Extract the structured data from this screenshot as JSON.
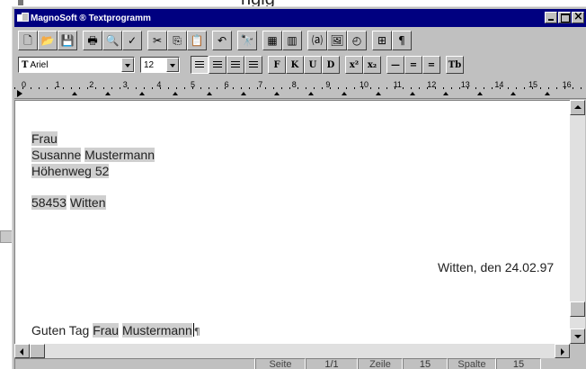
{
  "background": {
    "caption": "ngig"
  },
  "window": {
    "title": "MagnoSoft ® Textprogramm",
    "colors": {
      "titlebar": "#000080",
      "face": "#c0c0c0",
      "document": "#ffffff",
      "highlight": "#cfcfcf"
    }
  },
  "toolbar_standard": {
    "buttons": [
      {
        "name": "new-document-button",
        "icon": "new-document-icon",
        "glyph": "🗋"
      },
      {
        "name": "open-button",
        "icon": "open-folder-icon",
        "glyph": "📂"
      },
      {
        "name": "save-button",
        "icon": "floppy-disk-icon",
        "glyph": "💾"
      },
      {
        "name": "print-button",
        "icon": "printer-icon",
        "glyph": "🖶"
      },
      {
        "name": "print-preview-button",
        "icon": "print-preview-icon",
        "glyph": "🔍"
      },
      {
        "name": "spellcheck-button",
        "icon": "spellcheck-icon",
        "glyph": "✓"
      },
      {
        "name": "cut-button",
        "icon": "scissors-icon",
        "glyph": "✂"
      },
      {
        "name": "copy-button",
        "icon": "copy-icon",
        "glyph": "⎘"
      },
      {
        "name": "paste-button",
        "icon": "clipboard-icon",
        "glyph": "📋"
      },
      {
        "name": "undo-button",
        "icon": "undo-arrow-icon",
        "glyph": "↶"
      },
      {
        "name": "find-button",
        "icon": "binoculars-icon",
        "glyph": "🔭"
      },
      {
        "name": "insert-table-button",
        "icon": "table-icon",
        "glyph": "▦"
      },
      {
        "name": "columns-button",
        "icon": "columns-icon",
        "glyph": "▥"
      },
      {
        "name": "insert-field-button",
        "icon": "field-icon",
        "glyph": "⒜"
      },
      {
        "name": "insert-picture-button",
        "icon": "picture-icon",
        "glyph": "🖼"
      },
      {
        "name": "drawing-button",
        "icon": "drawing-icon",
        "glyph": "◴"
      },
      {
        "name": "frame-button",
        "icon": "frame-icon",
        "glyph": "⊞"
      },
      {
        "name": "show-formatting-button",
        "icon": "pilcrow-icon",
        "glyph": "¶"
      }
    ]
  },
  "toolbar_format": {
    "font_name": "Ariel",
    "font_icon": "truetype-font-icon",
    "font_glyph": "T",
    "font_size": "12",
    "align_buttons": [
      {
        "name": "align-left-button",
        "icon": "align-left-icon"
      },
      {
        "name": "align-center-button",
        "icon": "align-center-icon"
      },
      {
        "name": "align-right-button",
        "icon": "align-right-icon"
      },
      {
        "name": "align-justify-button",
        "icon": "align-justify-icon"
      }
    ],
    "style_buttons": [
      {
        "name": "bold-button",
        "icon": "bold-icon",
        "label": "F"
      },
      {
        "name": "italic-button",
        "icon": "italic-icon",
        "label": "K"
      },
      {
        "name": "underline-button",
        "icon": "underline-icon",
        "label": "U"
      },
      {
        "name": "strikethrough-button",
        "icon": "strikethrough-icon",
        "label": "D"
      }
    ],
    "script_buttons": [
      {
        "name": "superscript-button",
        "icon": "superscript-icon",
        "label": "x²"
      },
      {
        "name": "subscript-button",
        "icon": "subscript-icon",
        "label": "x₂"
      }
    ],
    "spacing_buttons": [
      {
        "name": "line-spacing-single-button",
        "icon": "line-spacing-single-icon",
        "label": "—"
      },
      {
        "name": "line-spacing-onehalf-button",
        "icon": "line-spacing-onehalf-icon",
        "label": "="
      },
      {
        "name": "line-spacing-double-button",
        "icon": "line-spacing-double-icon",
        "label": "="
      }
    ],
    "extra_button": {
      "name": "text-color-button",
      "icon": "text-color-icon",
      "label": "Tb"
    }
  },
  "ruler": {
    "numbers": [
      "0",
      "1",
      "2",
      "3",
      "4",
      "5",
      "6",
      "7",
      "8",
      "9",
      "10",
      "11",
      "12",
      "13",
      "14",
      "15",
      "16"
    ]
  },
  "document": {
    "lines": {
      "salutation_frau": "Frau",
      "first_name": "Susanne",
      "last_name": "Mustermann",
      "street": "Höhenweg 52",
      "zip": "58453",
      "city": "Witten",
      "date_line": "Witten, den 24.02.97",
      "greeting_prefix": "Guten Tag",
      "greeting_frau": "Frau",
      "greeting_name": "Mustermann",
      "paragraph_mark": "¶"
    }
  },
  "statusbar": {
    "page_label": "Seite",
    "page_value": "1/1",
    "line_label": "Zeile",
    "line_value": "15",
    "column_label": "Spalte",
    "column_value": "15"
  }
}
